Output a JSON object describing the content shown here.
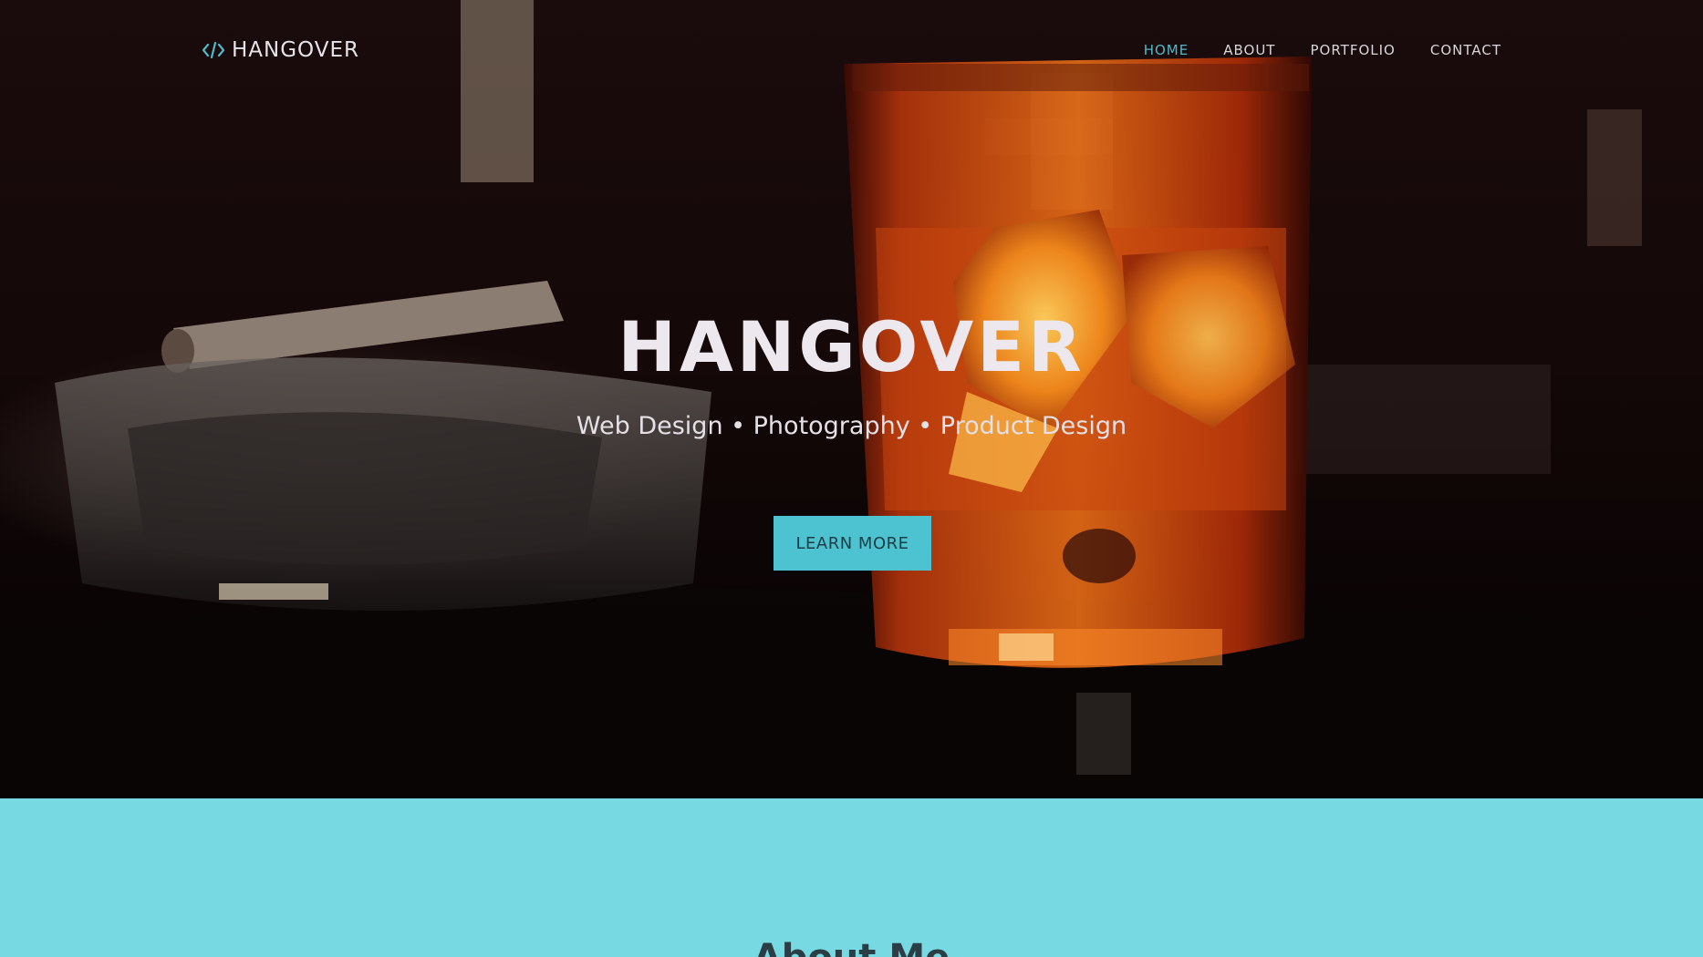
{
  "brand": {
    "name": "HANGOVER",
    "icon": "code-icon",
    "accent_color": "#4fb9c9"
  },
  "nav": {
    "items": [
      {
        "label": "HOME",
        "active": true
      },
      {
        "label": "ABOUT",
        "active": false
      },
      {
        "label": "PORTFOLIO",
        "active": false
      },
      {
        "label": "CONTACT",
        "active": false
      }
    ]
  },
  "hero": {
    "title": "HANGOVER",
    "subtitle": "Web Design • Photography • Product Design",
    "cta_label": "LEARN MORE",
    "cta_color": "#4dc2d0",
    "background_image": "whiskey-glass-and-cigar-photo"
  },
  "about": {
    "background_color": "#77dae3",
    "heading": "About Me"
  }
}
